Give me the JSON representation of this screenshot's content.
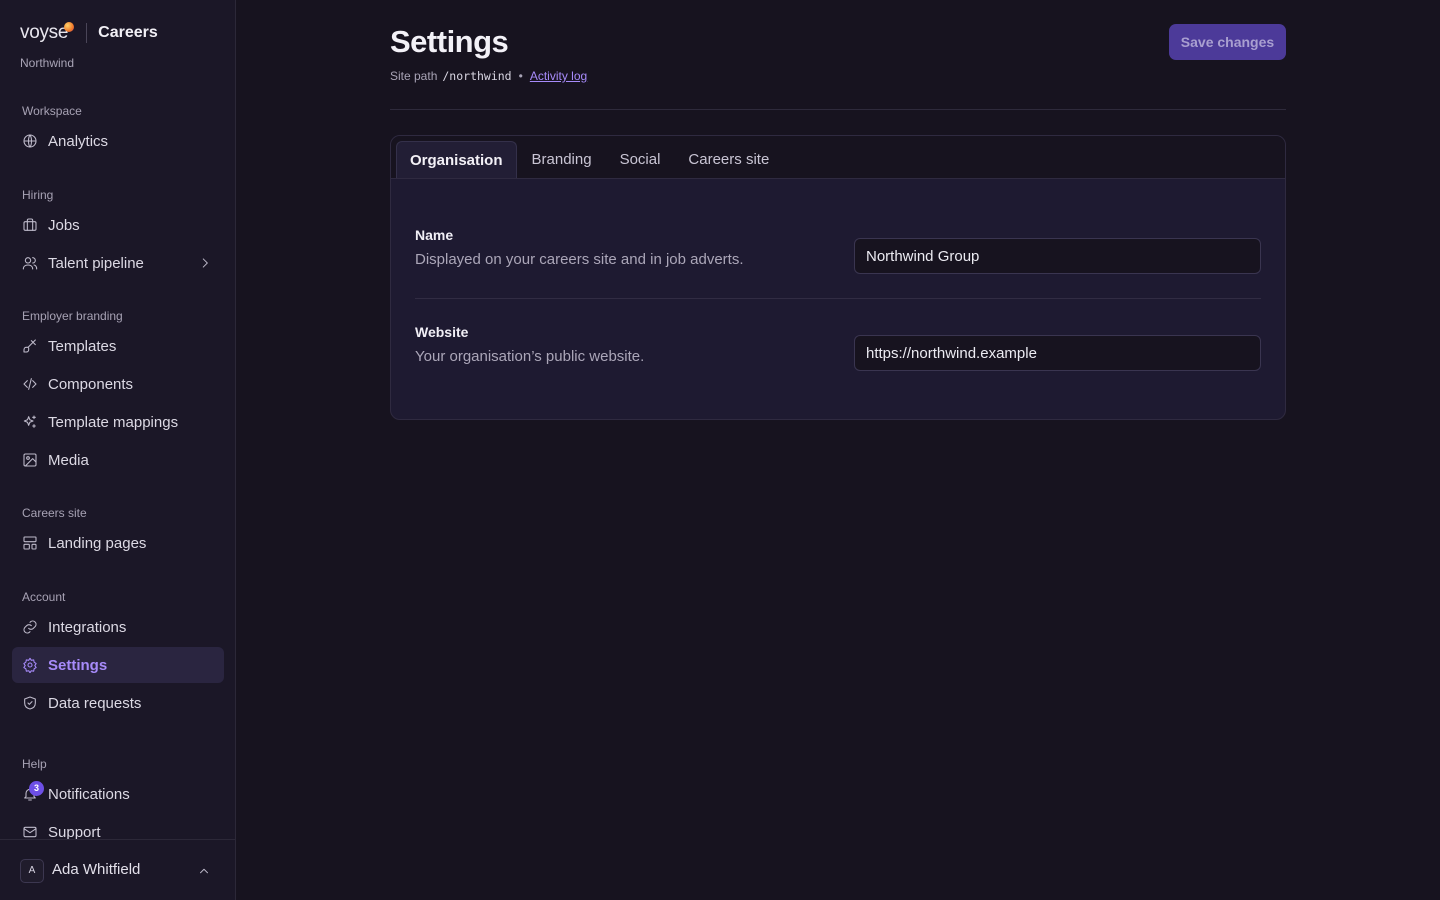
{
  "brand": {
    "logo_text": "voyse",
    "product": "Careers",
    "org": "Northwind"
  },
  "sidebar": {
    "groups": [
      {
        "label": "Workspace",
        "items": [
          {
            "label": "Analytics",
            "icon": "globe-icon"
          }
        ]
      },
      {
        "label": "Hiring",
        "items": [
          {
            "label": "Jobs",
            "icon": "briefcase-icon"
          },
          {
            "label": "Talent pipeline",
            "icon": "users-icon",
            "has_submenu": true
          }
        ]
      },
      {
        "label": "Employer branding",
        "items": [
          {
            "label": "Templates",
            "icon": "brush-icon"
          },
          {
            "label": "Components",
            "icon": "code-icon"
          },
          {
            "label": "Template mappings",
            "icon": "sparkles-icon"
          },
          {
            "label": "Media",
            "icon": "image-icon"
          }
        ]
      },
      {
        "label": "Careers site",
        "items": [
          {
            "label": "Landing pages",
            "icon": "layout-icon"
          }
        ]
      },
      {
        "label": "Account",
        "items": [
          {
            "label": "Integrations",
            "icon": "link-icon"
          },
          {
            "label": "Settings",
            "icon": "gear-icon",
            "active": true
          },
          {
            "label": "Data requests",
            "icon": "shield-icon"
          }
        ]
      },
      {
        "label": "Help",
        "items": [
          {
            "label": "Notifications",
            "icon": "bell-icon",
            "badge": "3"
          },
          {
            "label": "Support",
            "icon": "mail-icon"
          }
        ]
      }
    ]
  },
  "user": {
    "initial": "A",
    "name": "Ada Whitfield"
  },
  "page": {
    "title": "Settings",
    "site_path_label": "Site path",
    "site_path": "/northwind",
    "separator": "•",
    "activity_log": "Activity log",
    "save_label": "Save changes"
  },
  "tabs": [
    {
      "label": "Organisation",
      "active": true
    },
    {
      "label": "Branding"
    },
    {
      "label": "Social"
    },
    {
      "label": "Careers site"
    }
  ],
  "fields": {
    "name": {
      "label": "Name",
      "help": "Displayed on your careers site and in job adverts.",
      "value": "Northwind Group"
    },
    "website": {
      "label": "Website",
      "help": "Your organisation’s public website.",
      "value": "https://northwind.example"
    }
  },
  "colors": {
    "accent": "#a78bfa",
    "button": "#4c3a99",
    "background": "#17131f",
    "sidebar": "#1b1727",
    "badge": "#6d4fe6"
  }
}
